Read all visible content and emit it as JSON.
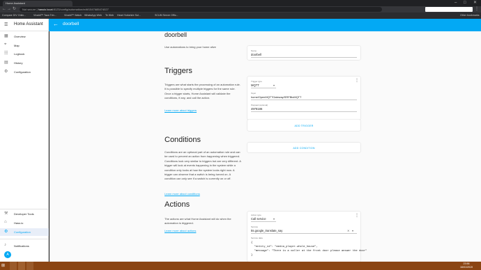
{
  "browser": {
    "tab_title": "Home Assistant",
    "url_secure": "Not secure",
    "url_host": "hassio.local",
    "url_path": ":8123/config/automation/edit/1547685474027",
    "bookmarks": [
      "Compare DIV Onlin...",
      "Vivaldi™ Taza Trin...",
      "Vivaldi™ Watch",
      "WhatsApp Web",
      "Te Web",
      "Heart Yorkshire Sol...",
      "SCUM Server Offic..."
    ],
    "other_bookmarks": "Other bookmarks"
  },
  "sidebar": {
    "title": "Home Assistant",
    "items": [
      {
        "label": "Overview",
        "icon": "overview-icon"
      },
      {
        "label": "Map",
        "icon": "map-icon"
      },
      {
        "label": "Logbook",
        "icon": "logbook-icon"
      },
      {
        "label": "History",
        "icon": "history-icon"
      },
      {
        "label": "Configuration",
        "icon": "configuration-icon"
      }
    ],
    "bottom_items": [
      {
        "label": "Developer Tools",
        "icon": "developer-tools-icon"
      },
      {
        "label": "Hass.io",
        "icon": "hassio-icon"
      },
      {
        "label": "Configuration",
        "icon": "configuration-icon",
        "active": true
      }
    ],
    "notifications": "Notifications",
    "avatar": "A"
  },
  "topbar": {
    "title": "doorbell"
  },
  "page": {
    "name_heading": "doorbell",
    "name_desc": "Use automations to bring your home alive",
    "name_field_label": "Name",
    "name_field_value": "doorbell",
    "triggers_heading": "Triggers",
    "triggers_desc": "Triggers are what starts the processing of an automation rule. It is possible to specify multiple triggers for the same rule. Once a trigger starts, Home Assistant will validate the conditions, if any, and call the action.",
    "triggers_link": "Learn more about triggers",
    "trigger_type_label": "Trigger type",
    "trigger_type_value": "MQTT",
    "topic_label": "Topic",
    "topic_value": "home/OpenMQTTGateway/SRFBtoMQTT",
    "payload_label": "Payload (optional)",
    "payload_value": "4978186",
    "add_trigger": "ADD TRIGGER",
    "conditions_heading": "Conditions",
    "conditions_desc": "Conditions are an optional part of an automation rule and can be used to prevent an action from happening when triggered. Conditions look very similar to triggers but are very different. A trigger will look at events happening in the system while a condition only looks at how the system looks right now. A trigger can observe that a switch is being turned on. A condition can only see if a switch is currently on or off.",
    "conditions_link": "Learn more about conditions",
    "add_condition": "ADD CONDITION",
    "actions_heading": "Actions",
    "actions_desc": "The actions are what Home Assistant will do when the automation is triggered.",
    "actions_link": "Learn more about actions",
    "action_type_label": "Action type",
    "action_type_value": "Call service",
    "service_label": "Service",
    "service_value": "tts.google_translate_say",
    "service_data_label": "Service data",
    "service_data": "{\n  \"entity_id\": \"media_player.whole_house\",\n  \"message\": \"There is a caller at the front door please answer the door\"\n}"
  },
  "taskbar": {
    "time": "23:56",
    "date": "16/01/2019"
  }
}
